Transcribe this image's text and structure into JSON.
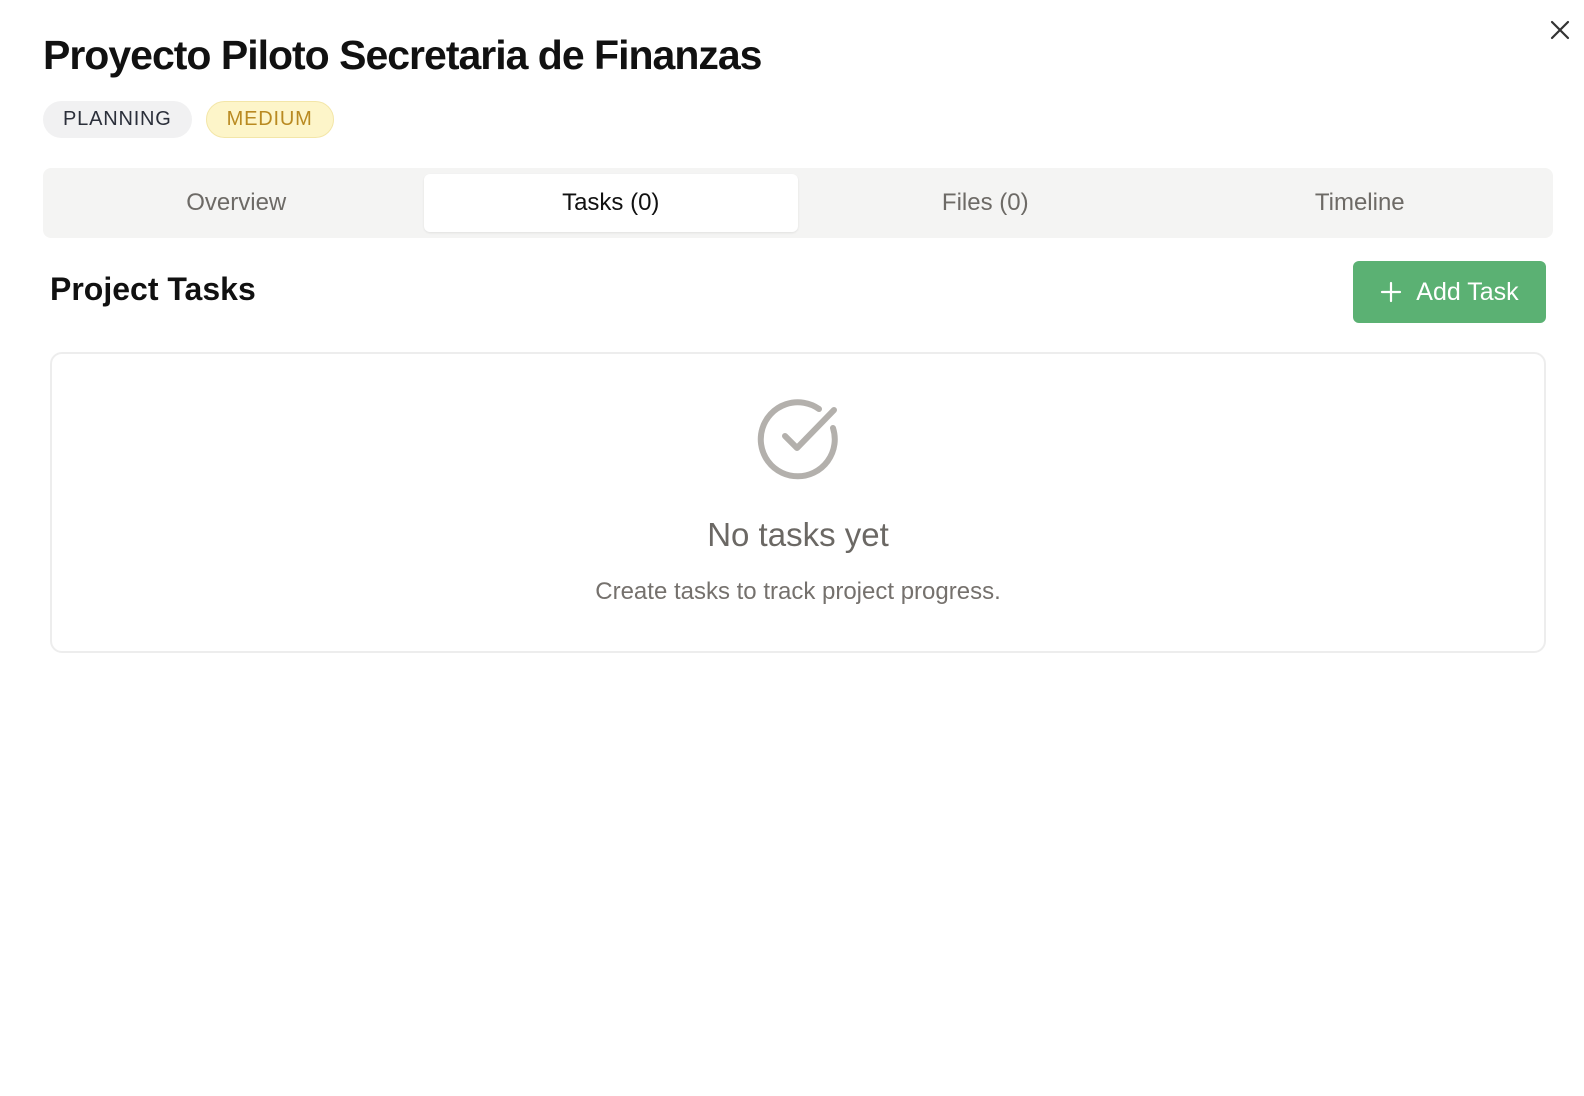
{
  "project": {
    "title": "Proyecto Piloto Secretaria de Finanzas",
    "status_badge": "PLANNING",
    "priority_badge": "MEDIUM"
  },
  "tabs": [
    {
      "label": "Overview",
      "active": false
    },
    {
      "label": "Tasks (0)",
      "active": true
    },
    {
      "label": "Files (0)",
      "active": false
    },
    {
      "label": "Timeline",
      "active": false
    }
  ],
  "tasks_section": {
    "title": "Project Tasks",
    "add_button_label": "Add Task",
    "empty_state": {
      "title": "No tasks yet",
      "subtitle": "Create tasks to track project progress.",
      "icon": "check-circle-icon"
    }
  },
  "icons": {
    "close": "close-icon",
    "add": "plus-icon"
  },
  "colors": {
    "accent_green": "#5bb173",
    "priority_text": "#b98a21",
    "priority_bg": "#fdf5c9",
    "status_bg": "#f1f1f2",
    "tabs_bg": "#f4f4f3",
    "muted_icon": "#b3b0ac"
  }
}
